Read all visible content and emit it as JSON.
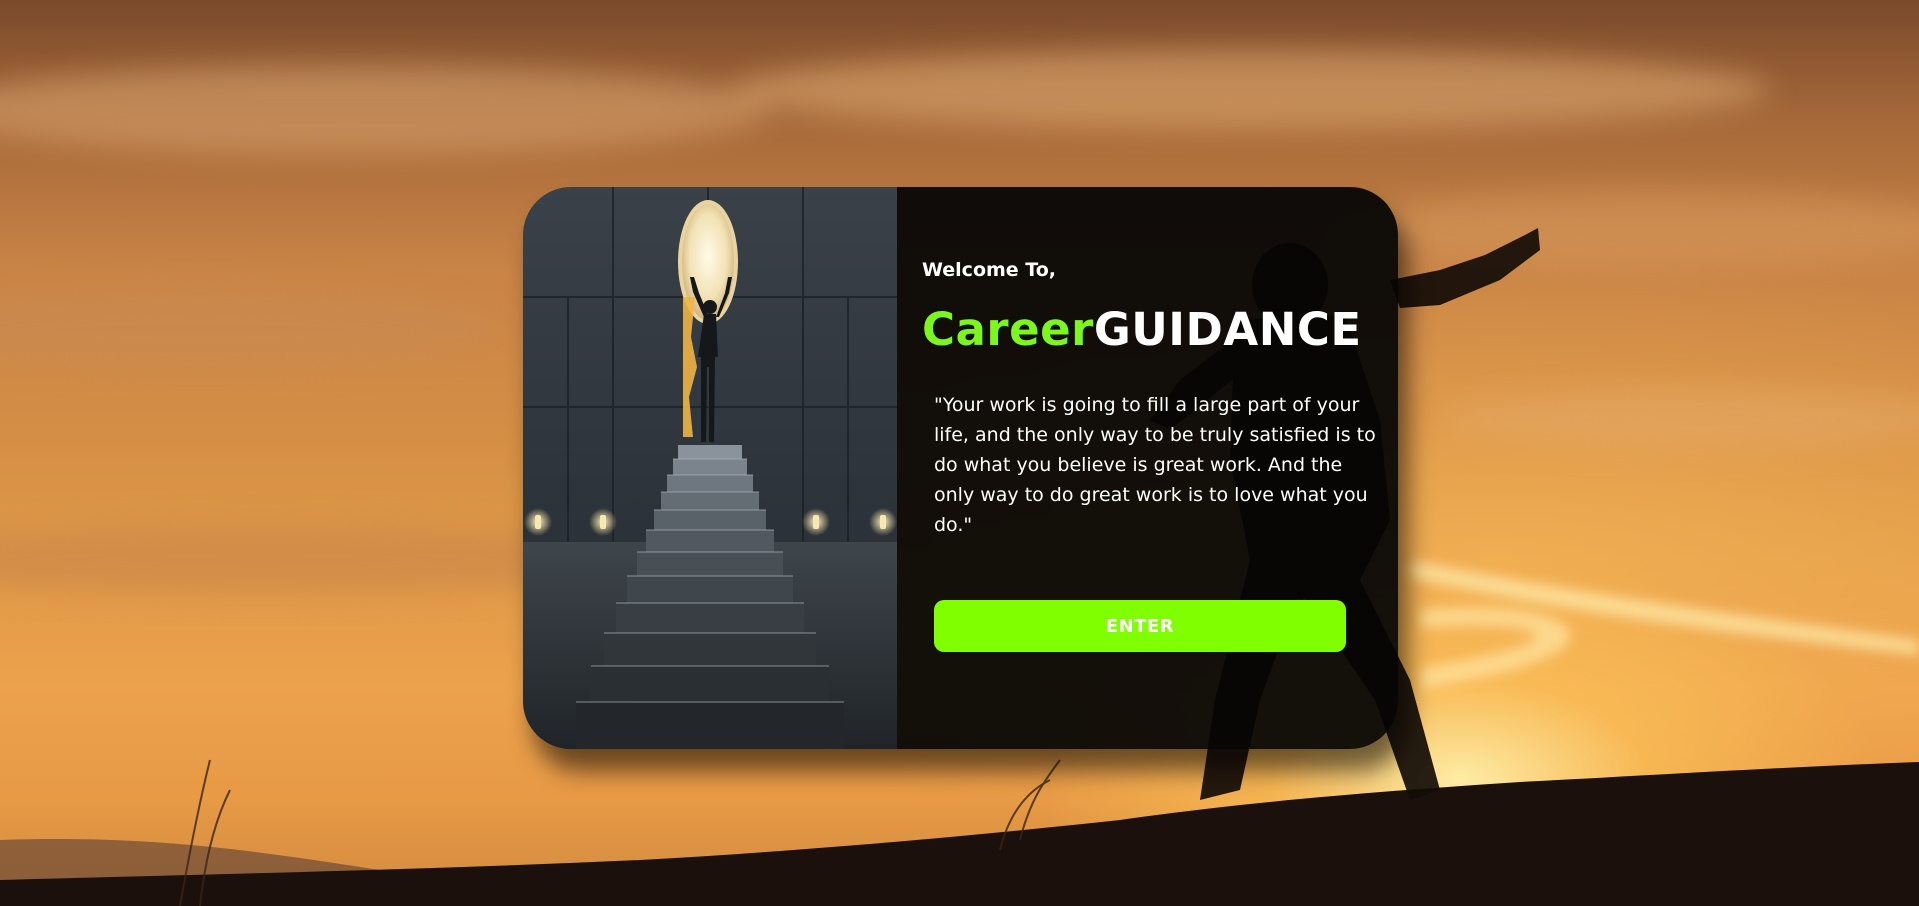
{
  "welcome": {
    "greeting": "Welcome To,",
    "brand_accent": "Career",
    "brand_main": "GUIDANCE",
    "quote": "\"Your work is going to fill a large part of your life, and the only way to be truly satisfied is to do what you believe is great work. And the only way to do great work is to love what you do.\"",
    "enter_label": "ENTER"
  },
  "colors": {
    "accent": "#7cf71d",
    "button": "#7fff00",
    "card_panel": "#050505",
    "sky": "#e09a48"
  },
  "images": {
    "background": "sunset-hill-silhouette",
    "card_illustration": "staircase-to-light-doorway"
  }
}
